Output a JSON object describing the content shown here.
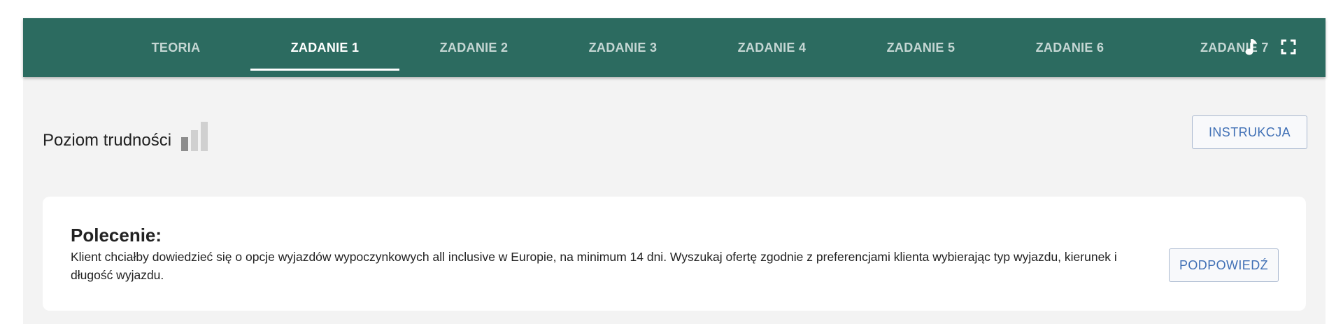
{
  "nav": {
    "tabs": [
      {
        "label": "TEORIA",
        "active": false
      },
      {
        "label": "ZADANIE 1",
        "active": true
      },
      {
        "label": "ZADANIE 2",
        "active": false
      },
      {
        "label": "ZADANIE 3",
        "active": false
      },
      {
        "label": "ZADANIE 4",
        "active": false
      },
      {
        "label": "ZADANIE 5",
        "active": false
      },
      {
        "label": "ZADANIE 6",
        "active": false
      },
      {
        "label": "ZADANIE 7",
        "active": false
      }
    ],
    "icons": [
      "music-note-icon",
      "fullscreen-icon"
    ]
  },
  "difficulty": {
    "label": "Poziom trudności",
    "level": 1,
    "max": 3
  },
  "instruction_button": "INSTRUKCJA",
  "task": {
    "title": "Polecenie:",
    "text": "Klient chciałby dowiedzieć się o opcje wyjazdów wypoczynkowych all inclusive w Europie, na minimum 14 dni. Wyszukaj ofertę zgodnie z preferencjami klienta wybierając typ wyjazdu, kierunek i długość wyjazdu.",
    "hint_button": "PODPOWIEDŹ"
  },
  "colors": {
    "header_bg": "#2c6b60",
    "page_bg": "#f3f3f3",
    "accent_blue": "#3f6fb5"
  }
}
